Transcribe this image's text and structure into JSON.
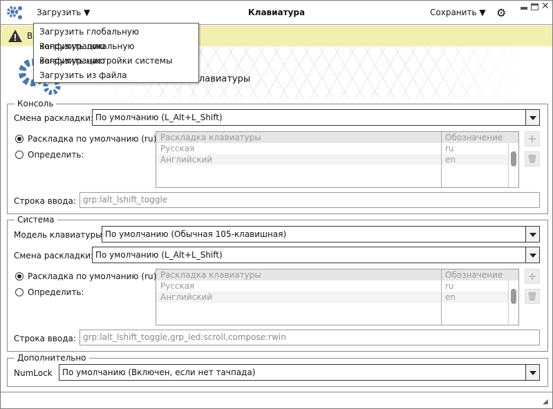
{
  "titlebar": {
    "load_label": "Загрузить",
    "title": "Клавиатура",
    "save_label": "Сохранить"
  },
  "menu": {
    "items": [
      "Загрузить глобальную конфигурацию",
      "Загрузить локальную конфигурацию",
      "Загрузить настройки системы",
      "Загрузить из файла"
    ]
  },
  "warning": {
    "text": "В"
  },
  "header": {
    "title": "лавиатуры"
  },
  "console": {
    "legend": "Консоль",
    "switch_label": "Смена раскладки:",
    "switch_value": "По умолчанию (L_Alt+L_Shift)",
    "radio_default": "Раскладка по умолчанию (ru)",
    "radio_custom": "Определить:",
    "table": {
      "headers": [
        "Раскладка клавиатуры",
        "Обозначение"
      ],
      "rows": [
        [
          "Русская",
          "ru"
        ],
        [
          "Английский",
          "en"
        ]
      ]
    },
    "input_label": "Строка ввода:",
    "input_value": "grp:lalt_lshift_toggle"
  },
  "system": {
    "legend": "Система",
    "model_label": "Модель клавиатуры:",
    "model_value": "По умолчанию (Обычная 105-клавишная)",
    "switch_label": "Смена раскладки:",
    "switch_value": "По умолчанию (L_Alt+L_Shift)",
    "radio_default": "Раскладка по умолчанию (ru)",
    "radio_custom": "Определить:",
    "table": {
      "headers": [
        "Раскладка клавиатуры",
        "Обозначение"
      ],
      "rows": [
        [
          "Русская",
          "ru"
        ],
        [
          "Английский",
          "en"
        ]
      ]
    },
    "input_label": "Строка ввода:",
    "input_value": "grp:lalt_lshift_toggle,grp_led:scroll,compose:rwin"
  },
  "extra": {
    "legend": "Дополнительно",
    "numlock_label": "NumLock",
    "numlock_value": "По умолчанию (Включен, если нет тачпада)"
  },
  "colors": {
    "accent": "#4a78b0",
    "warning_bg": "#f3efb0"
  }
}
